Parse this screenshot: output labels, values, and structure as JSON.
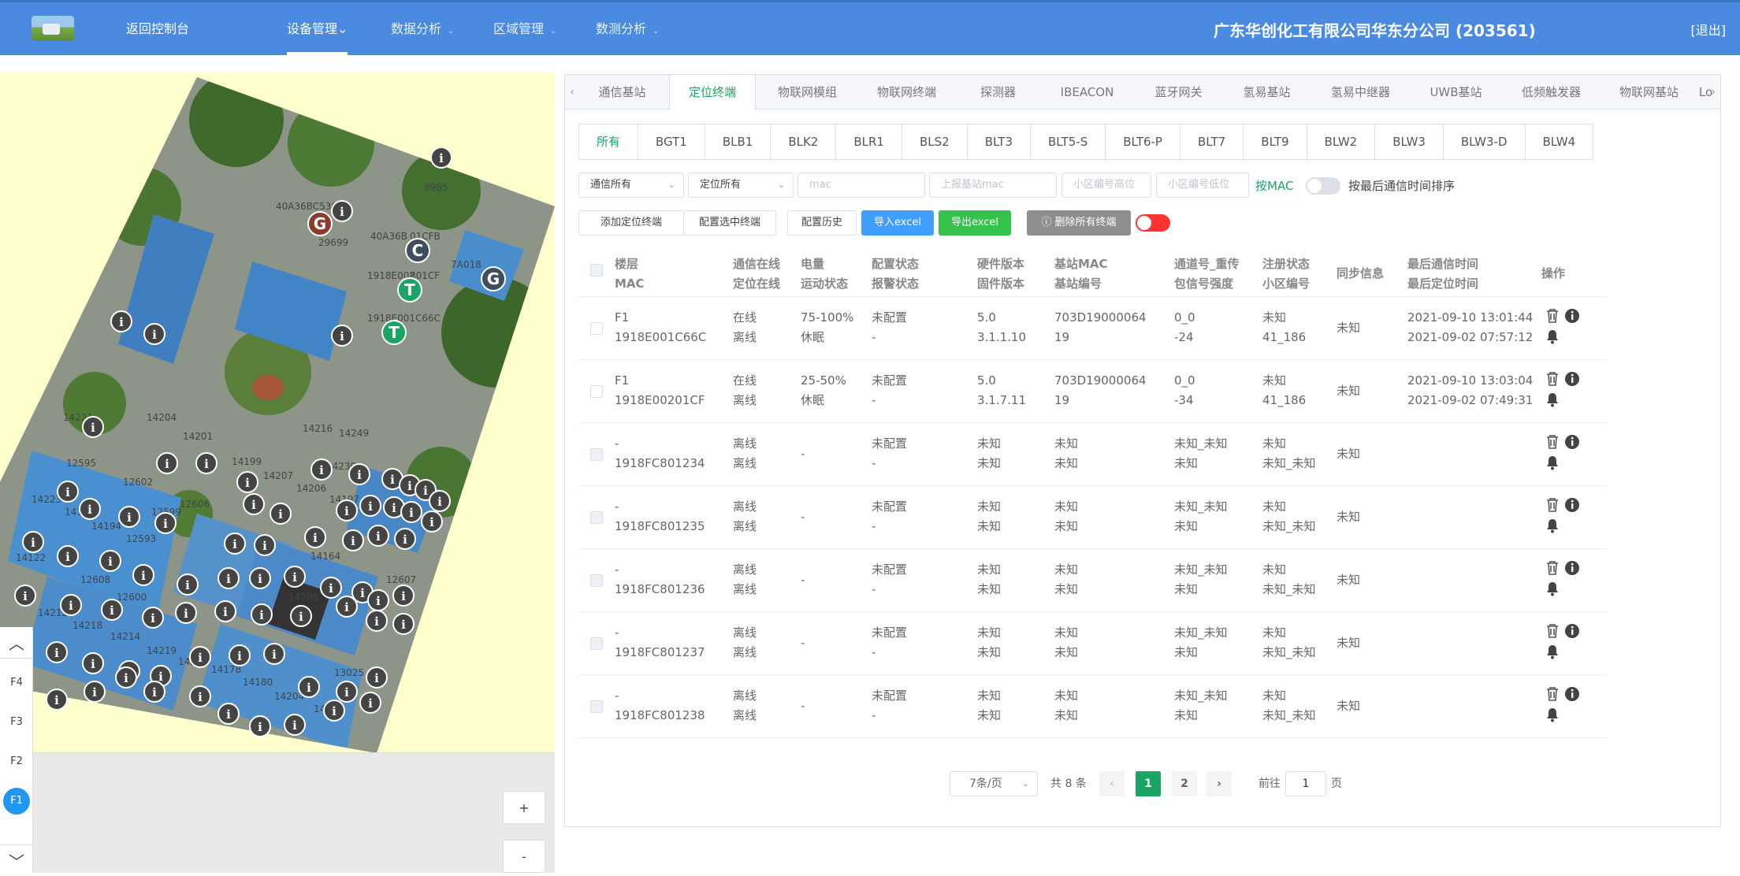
{
  "header": {
    "back_label": "返回控制台",
    "menus": [
      {
        "label": "设备管理",
        "active": true
      },
      {
        "label": "数据分析",
        "active": false
      },
      {
        "label": "区域管理",
        "active": false
      },
      {
        "label": "数测分析",
        "active": false
      }
    ],
    "company": "广东华创化工有限公司华东分公司 (203561)",
    "logout": "[退出]",
    "brand_color": "#4a8ae0"
  },
  "map": {
    "labels": [
      "40A36BC536B8",
      "8985",
      "29699",
      "40A36B",
      "01CFB",
      "1918E002",
      "801CF",
      "1918E001C66C",
      "7A018",
      "14221",
      "14216",
      "14249",
      "14204",
      "14201",
      "14199",
      "14207",
      "14230",
      "14206",
      "14197",
      "12602",
      "12599",
      "12606",
      "12595",
      "14198",
      "14223",
      "14194",
      "12593",
      "14122",
      "12608",
      "12600",
      "14212",
      "14218",
      "14214",
      "14219",
      "14213",
      "14205",
      "14178",
      "14180",
      "14204",
      "13025",
      "14179",
      "14164",
      "12607"
    ],
    "floors": [
      "F4",
      "F3",
      "F2",
      "F1"
    ],
    "active_floor": "F1",
    "zoom_in": "+",
    "zoom_out": "-"
  },
  "type_tabs": [
    {
      "label": "通信基站",
      "active": false
    },
    {
      "label": "定位终端",
      "active": true
    },
    {
      "label": "物联网模组",
      "active": false
    },
    {
      "label": "物联网终端",
      "active": false
    },
    {
      "label": "探测器",
      "active": false
    },
    {
      "label": "IBEACON",
      "active": false
    },
    {
      "label": "蓝牙网关",
      "active": false
    },
    {
      "label": "氢易基站",
      "active": false
    },
    {
      "label": "氢易中继器",
      "active": false
    },
    {
      "label": "UWB基站",
      "active": false
    },
    {
      "label": "低频触发器",
      "active": false
    },
    {
      "label": "物联网基站",
      "active": false
    },
    {
      "label": "Lo",
      "active": false
    }
  ],
  "model_tabs": [
    {
      "label": "所有",
      "active": true
    },
    {
      "label": "BGT1"
    },
    {
      "label": "BLB1"
    },
    {
      "label": "BLK2"
    },
    {
      "label": "BLR1"
    },
    {
      "label": "BLS2"
    },
    {
      "label": "BLT3"
    },
    {
      "label": "BLT5-S"
    },
    {
      "label": "BLT6-P"
    },
    {
      "label": "BLT7"
    },
    {
      "label": "BLT9"
    },
    {
      "label": "BLW2"
    },
    {
      "label": "BLW3"
    },
    {
      "label": "BLW3-D"
    },
    {
      "label": "BLW4"
    }
  ],
  "filters": {
    "comm_select": "通信所有",
    "loc_select": "定位所有",
    "mac_placeholder": "mac",
    "base_mac_placeholder": "上报基站mac",
    "cell_high_placeholder": "小区编号高位",
    "cell_low_placeholder": "小区编号低位",
    "mac_toggle_label": "按MAC",
    "sort_label": "按最后通信时间排序"
  },
  "actions": {
    "add": "添加定位终端",
    "config_selected": "配置选中终端",
    "config_history": "配置历史",
    "import_excel": "导入excel",
    "export_excel": "导出excel",
    "delete_all": "ⓘ 删除所有终端"
  },
  "table": {
    "headers": [
      {
        "line1": "楼层",
        "line2": "MAC"
      },
      {
        "line1": "通信在线",
        "line2": "定位在线"
      },
      {
        "line1": "电量",
        "line2": "运动状态"
      },
      {
        "line1": "配置状态",
        "line2": "报警状态"
      },
      {
        "line1": "硬件版本",
        "line2": "固件版本"
      },
      {
        "line1": "基站MAC",
        "line2": "基站编号"
      },
      {
        "line1": "通道号_重传",
        "line2": "包信号强度"
      },
      {
        "line1": "注册状态",
        "line2": "小区编号"
      },
      {
        "line1": "同步信息",
        "line2": ""
      },
      {
        "line1": "最后通信时间",
        "line2": "最后定位时间"
      },
      {
        "line1": "操作",
        "line2": ""
      }
    ],
    "rows": [
      {
        "floor": "F1",
        "mac": "1918E001C66C",
        "comm": "在线",
        "loc": "离线",
        "power": "75-100%",
        "motion": "休眠",
        "config": "未配置",
        "alarm": "-",
        "hw": "5.0",
        "fw": "3.1.1.10",
        "base_mac": "703D19000064",
        "base_no": "19",
        "channel": "0_0",
        "rssi": "-24",
        "reg": "未知",
        "cell": "41_186",
        "sync": "未知",
        "last_comm": "2021-09-10 13:01:44",
        "last_loc": "2021-09-02 07:57:12"
      },
      {
        "floor": "F1",
        "mac": "1918E00201CF",
        "comm": "在线",
        "loc": "离线",
        "power": "25-50%",
        "motion": "休眠",
        "config": "未配置",
        "alarm": "-",
        "hw": "5.0",
        "fw": "3.1.7.11",
        "base_mac": "703D19000064",
        "base_no": "19",
        "channel": "0_0",
        "rssi": "-34",
        "reg": "未知",
        "cell": "41_186",
        "sync": "未知",
        "last_comm": "2021-09-10 13:03:04",
        "last_loc": "2021-09-02 07:49:31"
      },
      {
        "floor": "-",
        "mac": "1918FC801234",
        "comm": "离线",
        "loc": "离线",
        "power": "-",
        "motion": "",
        "config": "未配置",
        "alarm": "-",
        "hw": "未知",
        "fw": "未知",
        "base_mac": "未知",
        "base_no": "未知",
        "channel": "未知_未知",
        "rssi": "未知",
        "reg": "未知",
        "cell": "未知_未知",
        "sync": "未知",
        "last_comm": "",
        "last_loc": ""
      },
      {
        "floor": "-",
        "mac": "1918FC801235",
        "comm": "离线",
        "loc": "离线",
        "power": "-",
        "motion": "",
        "config": "未配置",
        "alarm": "-",
        "hw": "未知",
        "fw": "未知",
        "base_mac": "未知",
        "base_no": "未知",
        "channel": "未知_未知",
        "rssi": "未知",
        "reg": "未知",
        "cell": "未知_未知",
        "sync": "未知",
        "last_comm": "",
        "last_loc": ""
      },
      {
        "floor": "-",
        "mac": "1918FC801236",
        "comm": "离线",
        "loc": "离线",
        "power": "-",
        "motion": "",
        "config": "未配置",
        "alarm": "-",
        "hw": "未知",
        "fw": "未知",
        "base_mac": "未知",
        "base_no": "未知",
        "channel": "未知_未知",
        "rssi": "未知",
        "reg": "未知",
        "cell": "未知_未知",
        "sync": "未知",
        "last_comm": "",
        "last_loc": ""
      },
      {
        "floor": "-",
        "mac": "1918FC801237",
        "comm": "离线",
        "loc": "离线",
        "power": "-",
        "motion": "",
        "config": "未配置",
        "alarm": "-",
        "hw": "未知",
        "fw": "未知",
        "base_mac": "未知",
        "base_no": "未知",
        "channel": "未知_未知",
        "rssi": "未知",
        "reg": "未知",
        "cell": "未知_未知",
        "sync": "未知",
        "last_comm": "",
        "last_loc": ""
      },
      {
        "floor": "-",
        "mac": "1918FC801238",
        "comm": "离线",
        "loc": "离线",
        "power": "-",
        "motion": "",
        "config": "未配置",
        "alarm": "-",
        "hw": "未知",
        "fw": "未知",
        "base_mac": "未知",
        "base_no": "未知",
        "channel": "未知_未知",
        "rssi": "未知",
        "reg": "未知",
        "cell": "未知_未知",
        "sync": "未知",
        "last_comm": "",
        "last_loc": ""
      }
    ]
  },
  "pagination": {
    "page_size": "7条/页",
    "total": "共 8 条",
    "pages": [
      "1",
      "2"
    ],
    "current": "1",
    "goto_label": "前往",
    "goto_value": "1",
    "page_suffix": "页"
  },
  "colors": {
    "accent": "#1aa565",
    "primary": "#409eff",
    "success": "#34c24a",
    "danger": "#ff3333"
  },
  "icons": {
    "trash": "trash-icon",
    "info": "info-icon",
    "bell": "bell-icon",
    "chevron_up": "chevron-up-icon",
    "chevron_down": "chevron-down-icon"
  }
}
